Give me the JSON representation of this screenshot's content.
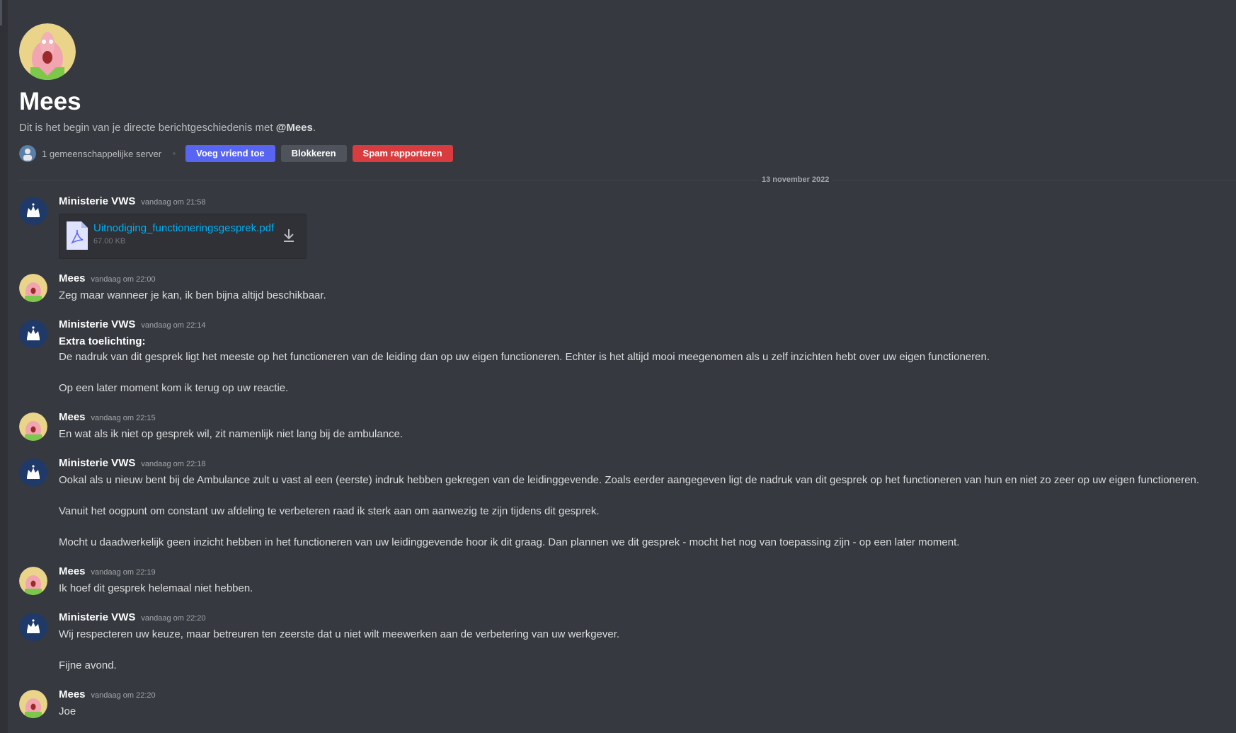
{
  "profile": {
    "name": "Mees",
    "intro_prefix": "Dit is het begin van je directe berichtgeschiedenis met",
    "intro_mention": "@Mees",
    "intro_suffix": ".",
    "mutual_servers": "1 gemeenschappelijke server",
    "buttons": {
      "add_friend": "Voeg vriend toe",
      "block": "Blokkeren",
      "report_spam": "Spam rapporteren"
    }
  },
  "divider_date": "13 november 2022",
  "messages": [
    {
      "author": "Ministerie VWS",
      "time": "vandaag om 21:58",
      "attachment": {
        "name": "Uitnodiging_functioneringsgesprek.pdf",
        "size": "67.00 KB"
      }
    },
    {
      "author": "Mees",
      "time": "vandaag om 22:00",
      "lines": [
        "Zeg maar wanneer je kan, ik ben bijna altijd beschikbaar."
      ]
    },
    {
      "author": "Ministerie VWS",
      "time": "vandaag om 22:14",
      "lines": [
        "Extra toelichting:",
        "De nadruk van dit gesprek ligt het meeste op het functioneren van de leiding dan op uw eigen functioneren. Echter is het altijd mooi meegenomen als u zelf inzichten hebt over uw eigen functioneren.",
        "Op een later moment kom ik terug op uw reactie."
      ]
    },
    {
      "author": "Mees",
      "time": "vandaag om 22:15",
      "lines": [
        "En wat als ik niet op gesprek wil, zit namenlijk niet lang bij de ambulance."
      ]
    },
    {
      "author": "Ministerie VWS",
      "time": "vandaag om 22:18",
      "lines": [
        "Ookal als u nieuw bent bij de Ambulance zult u vast al een (eerste) indruk hebben gekregen van de leidinggevende. Zoals eerder aangegeven ligt de nadruk van dit gesprek op het functioneren van hun en niet zo zeer op uw eigen functioneren.",
        "Vanuit het oogpunt om constant uw afdeling te verbeteren raad ik sterk aan om aanwezig te zijn tijdens dit gesprek.",
        "Mocht u daadwerkelijk geen inzicht hebben in het functioneren van uw leidinggevende hoor ik dit graag. Dan plannen we dit gesprek - mocht het nog van toepassing zijn - op een later moment."
      ]
    },
    {
      "author": "Mees",
      "time": "vandaag om 22:19",
      "lines": [
        "Ik hoef dit gesprek helemaal niet hebben."
      ]
    },
    {
      "author": "Ministerie VWS",
      "time": "vandaag om 22:20",
      "lines": [
        "Wij respecteren uw keuze, maar betreuren ten zeerste dat u niet wilt meewerken aan de verbetering van uw werkgever.",
        "Fijne avond."
      ]
    },
    {
      "author": "Mees",
      "time": "vandaag om 22:20",
      "lines": [
        "Joe"
      ]
    }
  ]
}
